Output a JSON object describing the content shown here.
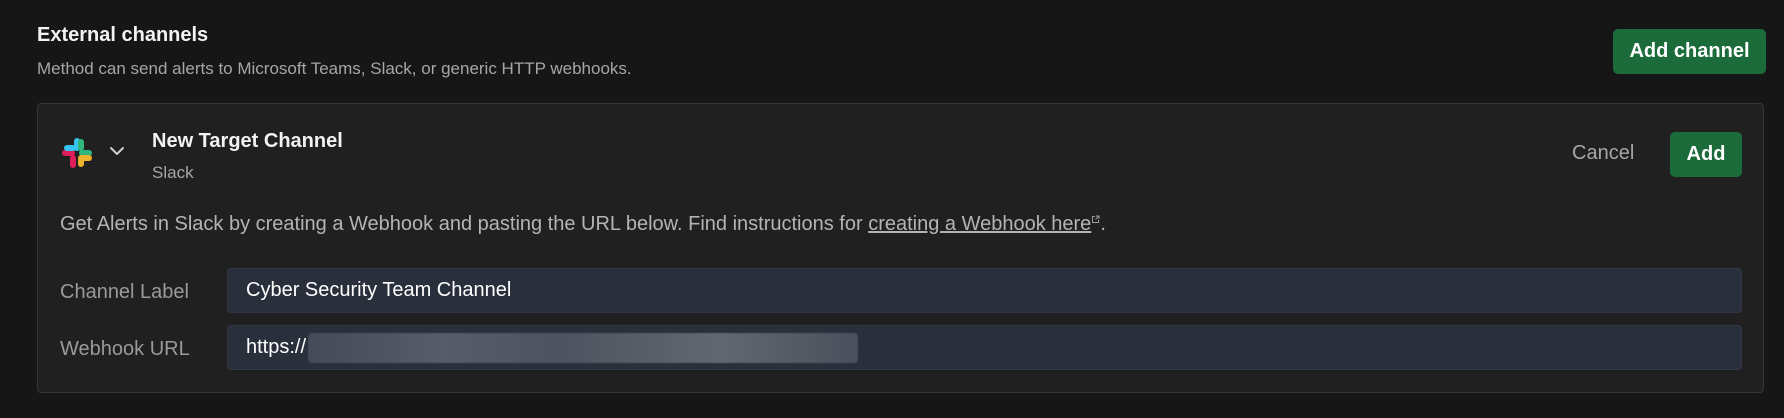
{
  "header": {
    "title": "External channels",
    "description": "Method can send alerts to Microsoft Teams, Slack, or generic HTTP webhooks.",
    "add_channel_label": "Add channel"
  },
  "card": {
    "logo_icon": "slack-logo-icon",
    "expand_icon": "chevron-down-icon",
    "channel_title": "New Target Channel",
    "channel_type": "Slack",
    "cancel_label": "Cancel",
    "add_label": "Add",
    "instructions_prefix": "Get Alerts in Slack by creating a Webhook and pasting the URL below. Find instructions for ",
    "instructions_link": "creating a Webhook here",
    "instructions_suffix": ".",
    "fields": {
      "channel_label": {
        "label": "Channel Label",
        "value": "Cyber Security Team Channel"
      },
      "webhook_url": {
        "label": "Webhook URL",
        "value_prefix": "https://"
      }
    }
  },
  "colors": {
    "background": "#161616",
    "card_background": "#202020",
    "accent_green": "#1c6b3a",
    "input_background": "#2a2f3c"
  }
}
